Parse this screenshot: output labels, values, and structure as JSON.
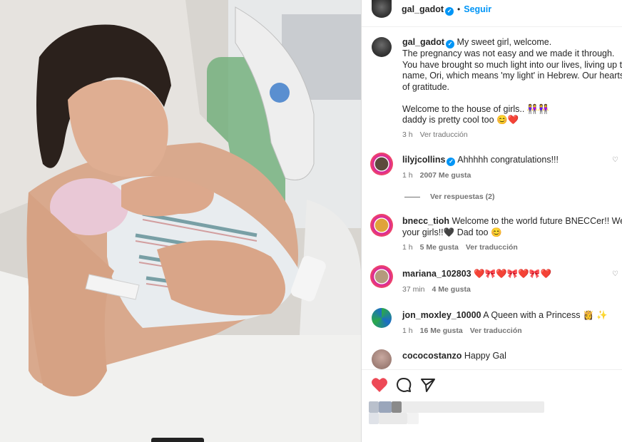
{
  "post": {
    "username": "gal_gadot",
    "follow_label": "Seguir",
    "caption_lines": [
      "My sweet girl, welcome.",
      "The pregnancy was not easy and we made it through.",
      "You have brought so much light into our lives, living up to",
      "name, Ori, which means 'my light' in Hebrew. Our hearts a",
      "of gratitude.",
      "",
      "Welcome to the house of girls.. 👭👭",
      "daddy is pretty cool too 😊❤️"
    ],
    "time": "3 h",
    "translate": "Ver traducción"
  },
  "comments": [
    {
      "user": "lilyjcollins",
      "verified": true,
      "text": "Ahhhhh congratulations!!!",
      "time": "1 h",
      "likes": "2007 Me gusta",
      "replies": "Ver respuestas (2)"
    },
    {
      "user": "bnecc_tioh",
      "text_line1": "Welcome to the world future BNECCer!! We lov",
      "text_line2": "your girls!!🖤 Dad too 😊",
      "time": "1 h",
      "likes": "5 Me gusta",
      "translate": "Ver traducción"
    },
    {
      "user": "mariana_102803",
      "text": "❤️🎀❤️🎀❤️🎀❤️",
      "time": "37 min",
      "likes": "4 Me gusta"
    },
    {
      "user": "jon_moxley_10000",
      "text": "A Queen with a Princess 👸 ✨",
      "time": "1 h",
      "likes": "16 Me gusta",
      "translate": "Ver traducción"
    },
    {
      "user": "cococostanzo",
      "text": "Happy Gal"
    }
  ],
  "colors": {
    "accent": "#0095f6",
    "like": "#ed4956",
    "muted": "#737373"
  },
  "icons": {
    "like": "heart-filled-icon",
    "comment": "comment-icon",
    "share": "send-icon",
    "more": "more-options-icon"
  }
}
